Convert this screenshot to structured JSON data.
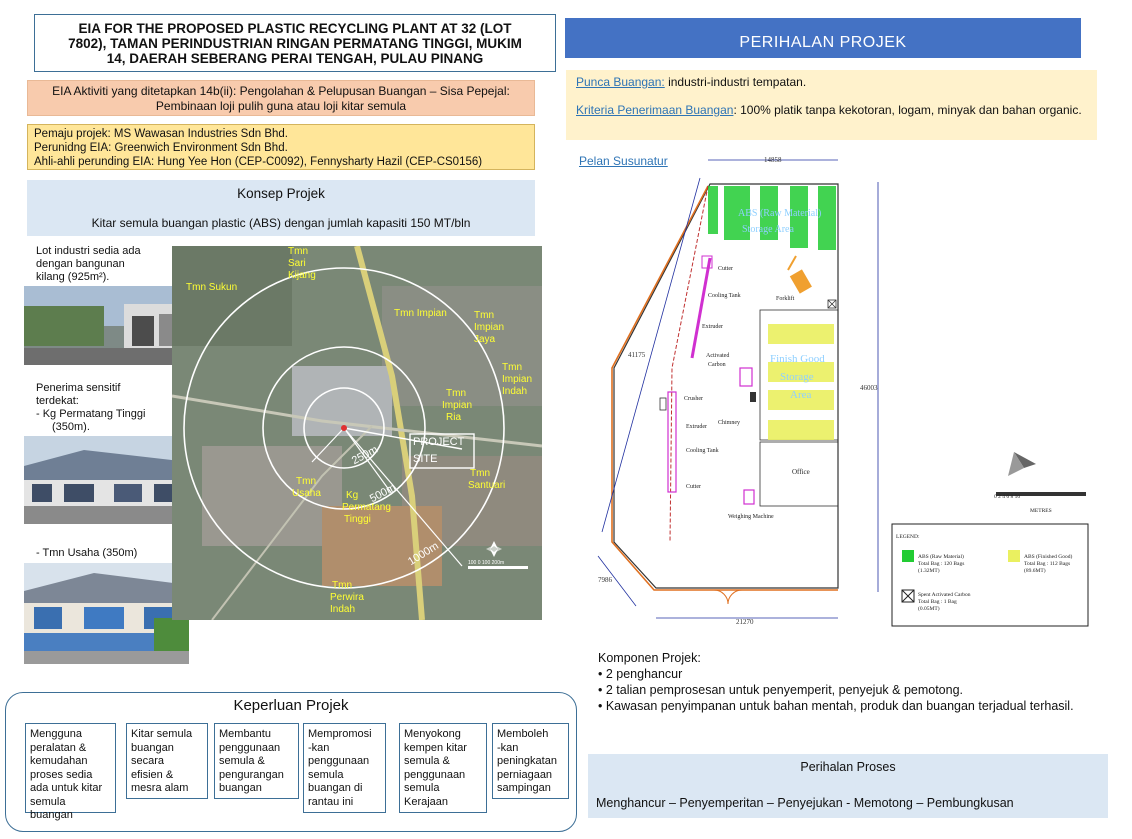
{
  "title": {
    "line1": "EIA FOR THE PROPOSED PLASTIC RECYCLING PLANT AT 32 (LOT",
    "line2": "7802), TAMAN PERINDUSTRIAN RINGAN PERMATANG TINGGI, MUKIM",
    "line3": "14, DAERAH SEBERANG PERAI TENGAH, PULAU PINANG"
  },
  "eia_activity": {
    "line1": "EIA Aktiviti yang ditetapkan 14b(ii): Pengolahan & Pelupusan Buangan – Sisa Pepejal:",
    "line2": "Pembinaan loji pulih guna atau loji kitar semula"
  },
  "pemaju": {
    "line1": "Pemaju projek: MS Wawasan Industries Sdn Bhd.",
    "line2": "Perunidng EIA: Greenwich Environment Sdn Bhd.",
    "line3": "Ahli-ahli perunding EIA: Hung Yee Hon (CEP-C0092), Fennysharty Hazil (CEP-CS0156)"
  },
  "konsep": {
    "heading": "Konsep Projek",
    "text": "Kitar semula buangan plastic (ABS) dengan jumlah kapasiti 150 MT/bln"
  },
  "left_notes": {
    "lot_line1": "Lot industri sedia ada",
    "lot_line2": "dengan bangunan",
    "lot_line3": "kilang (925m²).",
    "penerima_line1": "Penerima sensitif",
    "penerima_line2": "terdekat:",
    "penerima_item1": "-   Kg Permatang Tinggi (350m).",
    "penerima_item2": "-   Tmn Usaha (350m)"
  },
  "map": {
    "labels": {
      "tmn_sukun": "Tmn Sukun",
      "tmn_sari_1": "Tmn",
      "tmn_sari_2": "Sari",
      "tmn_sari_3": "Kijang",
      "tmn_impian": "Tmn Impian",
      "impian_jaya_1": "Tmn",
      "impian_jaya_2": "Impian",
      "impian_jaya_3": "Jaya",
      "impian_indah_1": "Tmn",
      "impian_indah_2": "Impian",
      "impian_indah_3": "Indah",
      "impian_ria_1": "Tmn",
      "impian_ria_2": "Impian",
      "impian_ria_3": "Ria",
      "project_1": "PROJECT",
      "project_2": "SITE",
      "tmn_santuari_1": "Tmn",
      "tmn_santuari_2": "Santuari",
      "tmn_usaha_1": "Tmn",
      "tmn_usaha_2": "Usaha",
      "kg_pt_1": "Kg",
      "kg_pt_2": "Permatang",
      "kg_pt_3": "Tinggi",
      "perwira_1": "Tmn",
      "perwira_2": "Perwira",
      "perwira_3": "Indah",
      "r250": "250m",
      "r500": "500m",
      "r1000": "1000m",
      "scale": "100   0    100   200m"
    }
  },
  "keperluan": {
    "heading": "Keperluan Projek",
    "boxes": [
      {
        "l1": "Mengguna",
        "l2": "peralatan &",
        "l3": "kemudahan",
        "l4": "proses sedia",
        "l5": "ada untuk kitar",
        "l6": "semula buangan"
      },
      {
        "l1": "Kitar semula",
        "l2": "buangan",
        "l3": "secara",
        "l4": "efisien &",
        "l5": "mesra alam",
        "l6": ""
      },
      {
        "l1": "Membantu",
        "l2": "penggunaan",
        "l3": "semula &",
        "l4": "pengurangan",
        "l5": "buangan",
        "l6": ""
      },
      {
        "l1": "Mempromosi",
        "l2": "-kan",
        "l3": "penggunaan",
        "l4": "semula",
        "l5": "buangan di",
        "l6": "rantau ini"
      },
      {
        "l1": "Menyokong",
        "l2": "kempen kitar",
        "l3": "semula &",
        "l4": "penggunaan",
        "l5": "semula",
        "l6": "Kerajaan"
      },
      {
        "l1": "Memboleh",
        "l2": "-kan",
        "l3": "peningkatan",
        "l4": "perniagaan",
        "l5": "sampingan",
        "l6": ""
      }
    ]
  },
  "perihalan": {
    "title": "PERIHALAN PROJEK",
    "punca_label": "Punca Buangan:",
    "punca_text": " industri-industri tempatan.",
    "kriteria_label": "Kriteria Penerimaan Buangan",
    "kriteria_text": ": 100% platik tanpa kekotoran, logam, minyak dan bahan organic."
  },
  "pelan": {
    "label": "Pelan Susunatur",
    "dims": {
      "top": "14858",
      "left": "41175",
      "right": "46003",
      "bottom": "21270",
      "corner": "7986"
    },
    "raw_area_1": "ABS (Raw Material)",
    "raw_area_2": "Storage Area",
    "finish_1": "Finish Good",
    "finish_2": "Storage",
    "finish_3": "Area",
    "cutter": "Cutter",
    "cooling_tank": "Cooling Tank",
    "extruder": "Extruder",
    "activated_1": "Activated",
    "activated_2": "Carbon",
    "crusher": "Crusher",
    "chimney": "Chimney",
    "forklift": "Forklift",
    "office": "Office",
    "weighing": "Weighing Machine",
    "scale_nums": "0     2      4      6      8     10",
    "metres": "METRES",
    "legend": {
      "title": "LEGEND:",
      "abs_raw_1": "ABS (Raw Material)",
      "abs_raw_2": "Total Bag : 120 Bags",
      "abs_raw_3": "(1.32MT)",
      "abs_fin_1": "ABS (Finished Good)",
      "abs_fin_2": "Total Bag : 112 Bags",
      "abs_fin_3": "(89.6MT)",
      "spent_1": "Spent Activated Carbon",
      "spent_2": "Total Bag : 1 Bag",
      "spent_3": "(0.05MT)"
    }
  },
  "komponen": {
    "heading": "Komponen Projek:",
    "item1": "•   2 penghancur",
    "item2": "•   2 talian pemprosesan untuk penyemperit, penyejuk & pemotong.",
    "item3": "•   Kawasan penyimpanan untuk bahan mentah, produk dan buangan terjadual terhasil."
  },
  "proses": {
    "heading": "Perihalan Proses",
    "text": "Menghancur – Penyemperitan – Penyejukan - Memotong – Pembungkusan"
  }
}
